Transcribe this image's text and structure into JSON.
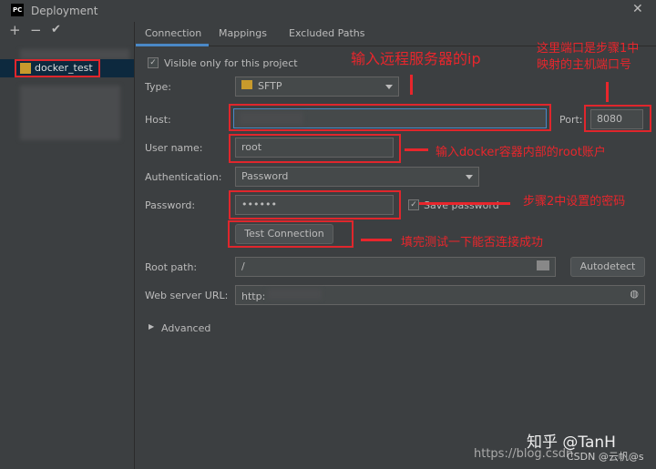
{
  "window": {
    "title": "Deployment",
    "logo": "PC"
  },
  "sidebar": {
    "add": "+",
    "remove": "−",
    "apply": "✔",
    "items": [
      {
        "label": "docker_test",
        "icon": "sftp-server-icon"
      }
    ]
  },
  "tabs": [
    {
      "label": "Connection",
      "active": true
    },
    {
      "label": "Mappings"
    },
    {
      "label": "Excluded Paths"
    }
  ],
  "form": {
    "visible_only": "Visible only for this project",
    "type_label": "Type:",
    "type_value": "SFTP",
    "host_label": "Host:",
    "host_value": "",
    "port_label": "Port:",
    "port_value": "8080",
    "user_label": "User name:",
    "user_value": "root",
    "auth_label": "Authentication:",
    "auth_value": "Password",
    "password_label": "Password:",
    "password_value": "••••••",
    "save_password": "Save password",
    "test_button": "Test Connection",
    "root_label": "Root path:",
    "root_value": "/",
    "autodetect": "Autodetect",
    "web_label": "Web server URL:",
    "web_value": "http:",
    "advanced": "Advanced"
  },
  "annotations": {
    "host": "输入远程服务器的ip",
    "port_line1": "这里端口是步骤1中",
    "port_line2": "映射的主机端口号",
    "user": "输入docker容器内部的root账户",
    "password": "步骤2中设置的密码",
    "test": "填完测试一下能否连接成功"
  },
  "watermark": {
    "zhihu": "知乎 @TanH",
    "url": "https://blog.csdn",
    "csdn": "CSDN @云帆@s"
  },
  "colors": {
    "accent": "#4a88c7",
    "annotation": "#e8262c"
  }
}
